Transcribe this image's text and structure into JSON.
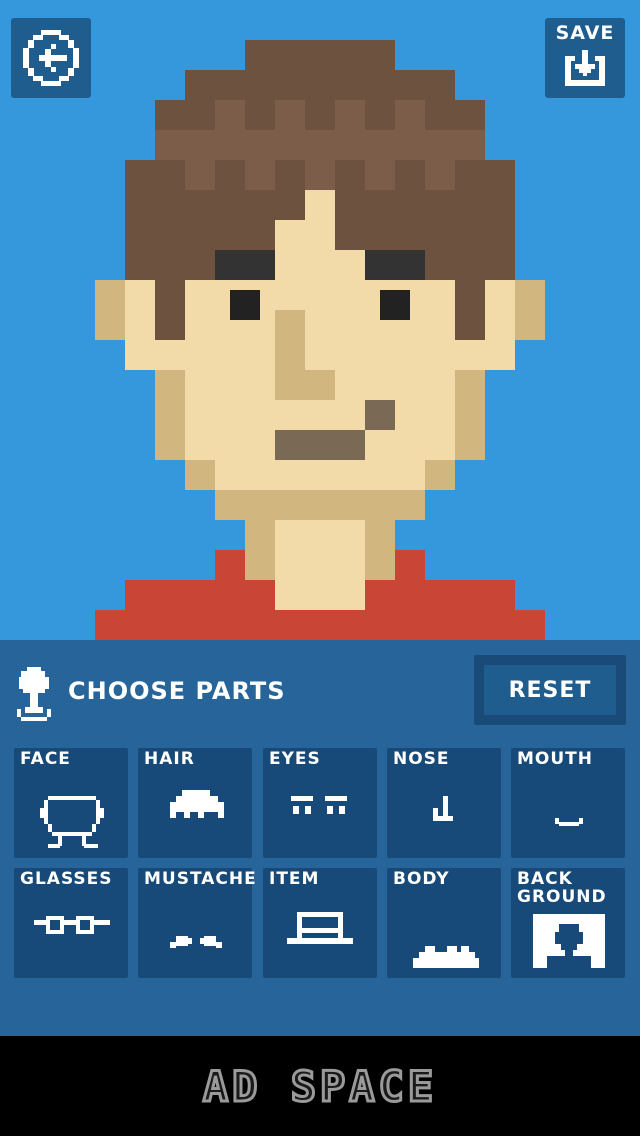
{
  "top": {
    "back_icon": "back-arrow-circle-icon",
    "save_label": "SAVE",
    "save_icon": "download-box-icon"
  },
  "panel": {
    "choose_label": "CHOOSE PARTS",
    "choose_icon": "joystick-icon",
    "reset_label": "RESET"
  },
  "parts": [
    {
      "label": "FACE",
      "icon": "face-outline-icon"
    },
    {
      "label": "HAIR",
      "icon": "hair-icon"
    },
    {
      "label": "EYES",
      "icon": "eyes-icon"
    },
    {
      "label": "NOSE",
      "icon": "nose-icon"
    },
    {
      "label": "MOUTH",
      "icon": "mouth-icon"
    },
    {
      "label": "GLASSES",
      "icon": "glasses-icon"
    },
    {
      "label": "MUSTACHE",
      "icon": "mustache-icon"
    },
    {
      "label": "ITEM",
      "icon": "hat-icon"
    },
    {
      "label": "BODY",
      "icon": "body-icon"
    },
    {
      "label": "BACK\nGROUND",
      "icon": "background-icon"
    }
  ],
  "ad": {
    "label": "AD SPACE"
  },
  "colors": {
    "background": "#3597dc",
    "hair": "#6e5240",
    "hair_highlight": "#7b5d49",
    "skin": "#f2dba8",
    "skin_shadow": "#d2b67f",
    "eyebrow": "#333333",
    "mouth": "#7a6a55",
    "shirt": "#c94536",
    "panel": "#27649a",
    "tile": "#174a78"
  }
}
